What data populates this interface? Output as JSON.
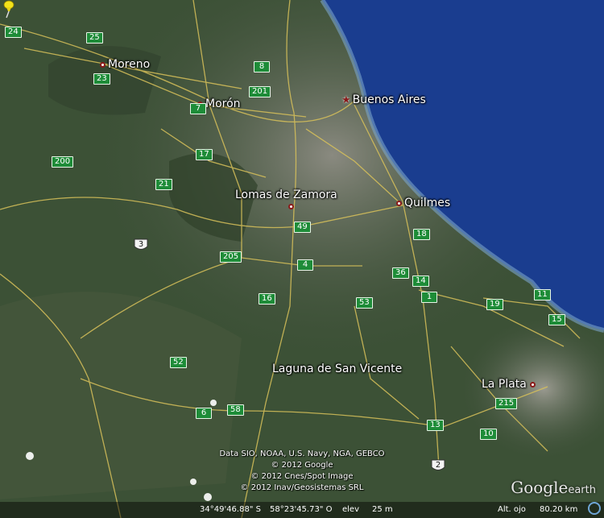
{
  "map": {
    "places": [
      {
        "id": "moreno",
        "label": "Moreno",
        "marker": "dot"
      },
      {
        "id": "moron",
        "label": "Morón",
        "marker": "dot"
      },
      {
        "id": "buenos_aires",
        "label": "Buenos Aires",
        "marker": "star"
      },
      {
        "id": "lomas",
        "label": "Lomas de Zamora",
        "marker": "dot"
      },
      {
        "id": "quilmes",
        "label": "Quilmes",
        "marker": "dot"
      },
      {
        "id": "la_plata",
        "label": "La Plata",
        "marker": "dot"
      }
    ],
    "placemark": {
      "label": "Laguna de San Vicente",
      "icon": "yellow-pushpin-icon"
    },
    "road_shields": [
      "24",
      "25",
      "23",
      "8",
      "201",
      "7",
      "17",
      "200",
      "21",
      "49",
      "18",
      "4",
      "205",
      "36",
      "14",
      "1",
      "16",
      "53",
      "19",
      "11",
      "15",
      "52",
      "6",
      "58",
      "215",
      "13",
      "10"
    ],
    "national_routes": [
      "3",
      "2"
    ],
    "colors": {
      "water": "#1a3d8f",
      "land": "#3a4f36",
      "roads": "#d8c15a",
      "shield": "#1e8c38",
      "marker": "#8a1a1a"
    }
  },
  "attribution": {
    "line1": "Data SIO, NOAA, U.S. Navy, NGA, GEBCO",
    "line2": "© 2012 Google",
    "line3": "© 2012 Cnes/Spot Image",
    "line4": "© 2012 Inav/Geosistemas SRL"
  },
  "status": {
    "lat": "34°49'46.88\" S",
    "lon": "58°23'45.73\" O",
    "elev_label": "elev",
    "elev_value": "25 m",
    "alt_label": "Alt. ojo",
    "alt_value": "80.20 km"
  },
  "logo": {
    "main": "Google",
    "suffix": "earth"
  }
}
